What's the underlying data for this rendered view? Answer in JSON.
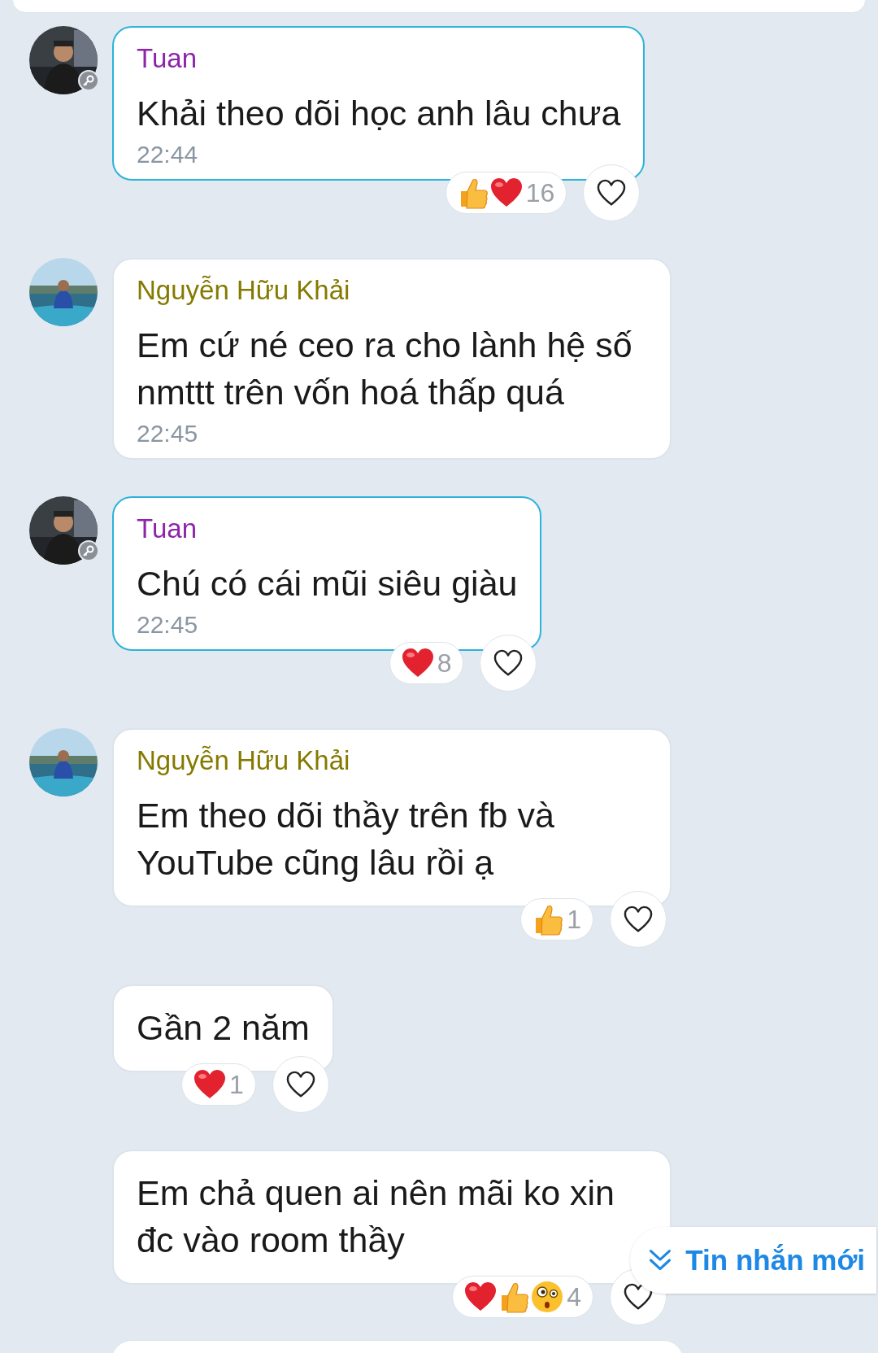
{
  "messages": [
    {
      "avatar": {
        "kind": "picture",
        "admin": true
      },
      "sender": "Tuan",
      "color": "#8e24aa",
      "highlighted": true,
      "text": "Khải theo dõi học anh lâu chưa",
      "time": "22:44",
      "reactions": {
        "emojis": [
          {
            "kind": "like"
          },
          {
            "kind": "heart"
          }
        ],
        "count": "16"
      }
    },
    {
      "avatar": {
        "kind": "picture",
        "admin": false
      },
      "sender": "Nguyễn Hữu Khải",
      "color": "#857a00",
      "highlighted": false,
      "text": "Em cứ né ceo ra cho lành hệ số nmttt trên vốn hoá thấp quá",
      "time": "22:45"
    },
    {
      "avatar": {
        "kind": "picture",
        "admin": true
      },
      "sender": "Tuan",
      "color": "#8e24aa",
      "highlighted": true,
      "text": "Chú có cái mũi siêu giàu",
      "time": "22:45",
      "reactions": {
        "emojis": [
          {
            "kind": "heart"
          }
        ],
        "count": "8"
      }
    },
    {
      "avatar": {
        "kind": "picture",
        "admin": false
      },
      "sender": "Nguyễn Hữu Khải",
      "color": "#857a00",
      "highlighted": false,
      "text": "Em theo dõi thầy trên fb và YouTube cũng lâu rồi ạ",
      "reactions": {
        "emojis": [
          {
            "kind": "like"
          }
        ],
        "count": "1"
      }
    },
    {
      "highlighted": false,
      "text": "Gần 2 năm",
      "reactions": {
        "emojis": [
          {
            "kind": "heart"
          }
        ],
        "count": "1"
      }
    },
    {
      "highlighted": false,
      "text": "Em chả quen ai nên mãi ko xin đc vào room thầy",
      "reactions": {
        "emojis": [
          {
            "kind": "heart"
          },
          {
            "kind": "like"
          },
          {
            "kind": "wow"
          }
        ],
        "count": "4"
      }
    }
  ],
  "new_messages_button": {
    "label": "Tin nhắn mới"
  }
}
